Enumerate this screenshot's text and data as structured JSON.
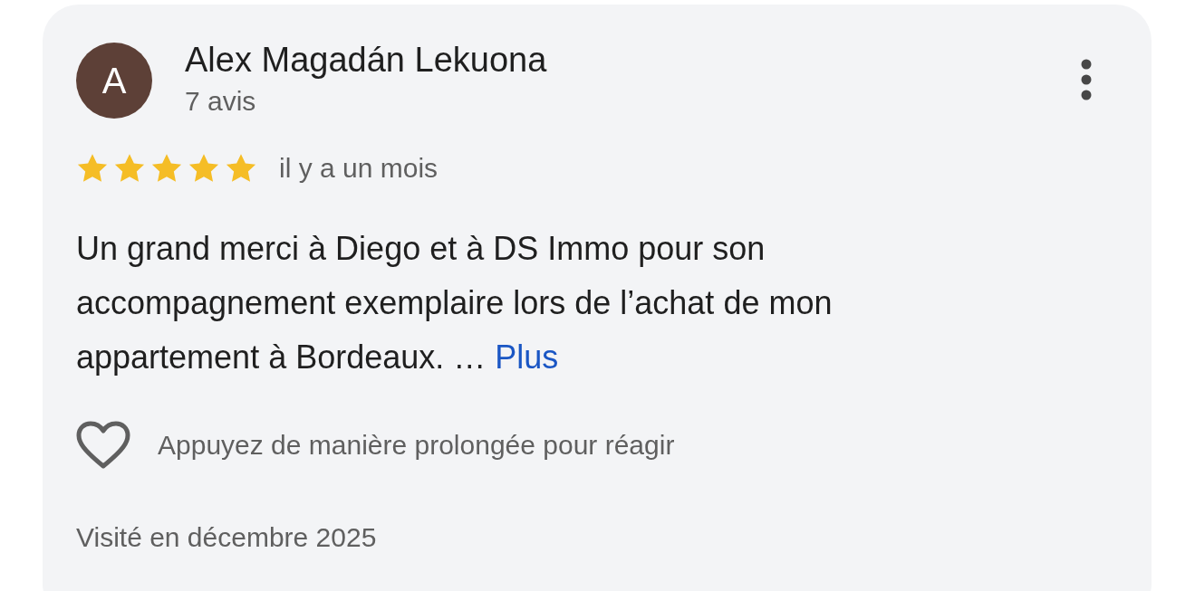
{
  "review": {
    "author": {
      "initial": "A",
      "name": "Alex Magadán Lekuona",
      "review_count": "7 avis"
    },
    "stars": 5,
    "time": "il y a un mois",
    "text": "Un grand merci à Diego et à DS Immo pour son accompagnement exemplaire lors de l’achat de mon appartement à Bordeaux. …",
    "more_link": "Plus",
    "reaction_hint": "Appuyez de manière prolongée pour réagir",
    "liked": false,
    "visited": "Visité en décembre 2025"
  }
}
